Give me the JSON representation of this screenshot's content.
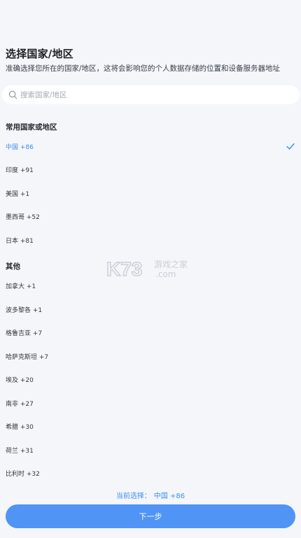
{
  "header": {
    "title": "选择国家/地区",
    "subtitle": "准确选择您所在的国家/地区，这将会影响您的个人数据存储的位置和设备服务器地址"
  },
  "search": {
    "placeholder": "搜索国家/地区",
    "icon": "search-icon"
  },
  "sections": {
    "common_title": "常用国家或地区",
    "other_title": "其他"
  },
  "common_list": [
    {
      "label": "中国 +86",
      "selected": true
    },
    {
      "label": "印度 +91"
    },
    {
      "label": "美国 +1"
    },
    {
      "label": "墨西哥 +52"
    },
    {
      "label": "日本 +81"
    }
  ],
  "other_list": [
    {
      "label": "加拿大 +1"
    },
    {
      "label": "波多黎各 +1"
    },
    {
      "label": "格鲁吉亚 +7"
    },
    {
      "label": "哈萨克斯坦 +7"
    },
    {
      "label": "埃及 +20"
    },
    {
      "label": "南非 +27"
    },
    {
      "label": "希腊 +30"
    },
    {
      "label": "荷兰 +31"
    },
    {
      "label": "比利时 +32"
    }
  ],
  "footer": {
    "current_label": "当前选择：",
    "current_value": "中国 +86",
    "next_button": "下一步"
  },
  "watermark": {
    "brand": "K73",
    "text_line1": "游戏之家",
    "text_line2": ".com"
  },
  "colors": {
    "accent": "#3d8ef0",
    "button": "#5094f6",
    "background": "#f4f6fa"
  }
}
